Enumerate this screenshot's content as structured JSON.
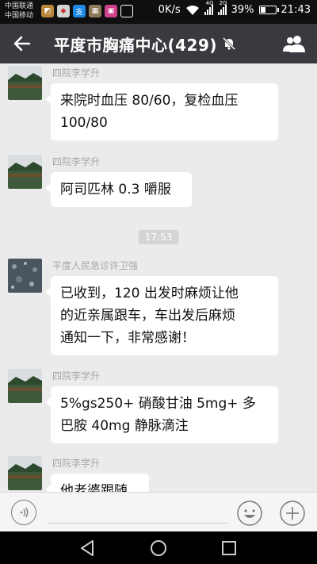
{
  "status_bar": {
    "carrier1": "中国联通",
    "carrier2": "中国移动",
    "net_speed": "0K/s",
    "signal1_label": "4G",
    "signal2_label": "2G",
    "battery_pct": "39%",
    "battery_level": 0.39,
    "time": "21:43",
    "app_icons": [
      "photo-icon",
      "app-icon",
      "alipay-icon",
      "gallery-icon",
      "image-icon",
      "mail-icon"
    ]
  },
  "header": {
    "title": "平度市胸痛中心(429)",
    "muted": true
  },
  "messages": [
    {
      "sender": "四院李学升",
      "lines": [
        "来院时血压 80/60，复检血压",
        "100/80"
      ],
      "avatar": "landscape"
    },
    {
      "sender": "四院李学升",
      "lines": [
        "阿司匹林 0.3 嚼服"
      ],
      "avatar": "landscape"
    },
    {
      "sender": "平度人民急诊许卫强",
      "lines": [
        "已收到，120 出发时麻烦让他",
        "的近亲属跟车，车出发后麻烦",
        "通知一下，非常感谢！"
      ],
      "avatar": "rain"
    },
    {
      "sender": "四院李学升",
      "lines": [
        "5%gs250+ 硝酸甘油 5mg+ 多",
        "巴胺 40mg 静脉滴注"
      ],
      "avatar": "landscape"
    },
    {
      "sender": "四院李学升",
      "lines": [
        "他老婆跟随"
      ],
      "avatar": "landscape"
    }
  ],
  "time_divider": "17:53",
  "colors": {
    "titlebar": "#393a3f",
    "chat_bg": "#ebebeb",
    "bubble": "#ffffff",
    "sender_text": "#a8a8a8"
  }
}
